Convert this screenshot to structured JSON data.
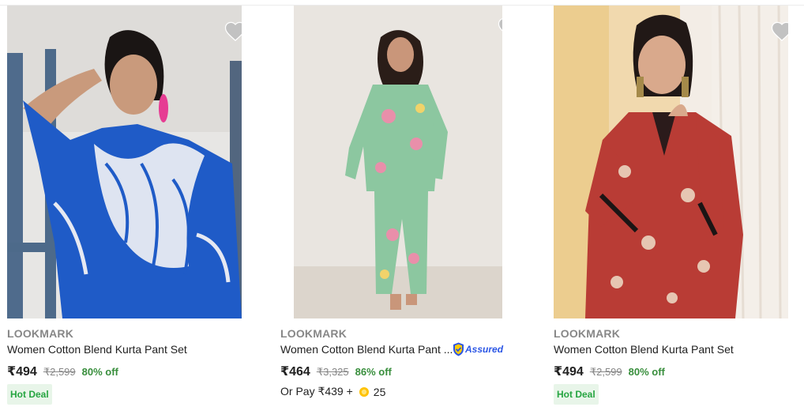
{
  "products": [
    {
      "brand": "LOOKMARK",
      "title": "Women Cotton Blend Kurta Pant Set",
      "price": "₹494",
      "mrp": "₹2,599",
      "discount": "80% off",
      "badge": "Hot Deal"
    },
    {
      "brand": "LOOKMARK",
      "title": "Women Cotton Blend Kurta Pant ...",
      "price": "₹464",
      "mrp": "₹3,325",
      "discount": "86% off",
      "assured_label": "Assured",
      "pay_prefix": "Or Pay ₹439 +",
      "pay_coins": "25"
    },
    {
      "brand": "LOOKMARK",
      "title": "Women Cotton Blend Kurta Pant Set",
      "price": "₹494",
      "mrp": "₹2,599",
      "discount": "80% off",
      "badge": "Hot Deal"
    }
  ],
  "colors": {
    "discount_green": "#388e3c",
    "badge_bg": "#e8f5e9",
    "assured_blue": "#2a55e5",
    "wishlist_grey": "#c2c2c2"
  },
  "icons": [
    "heart-icon",
    "assured-shield-icon",
    "supercoin-icon"
  ]
}
